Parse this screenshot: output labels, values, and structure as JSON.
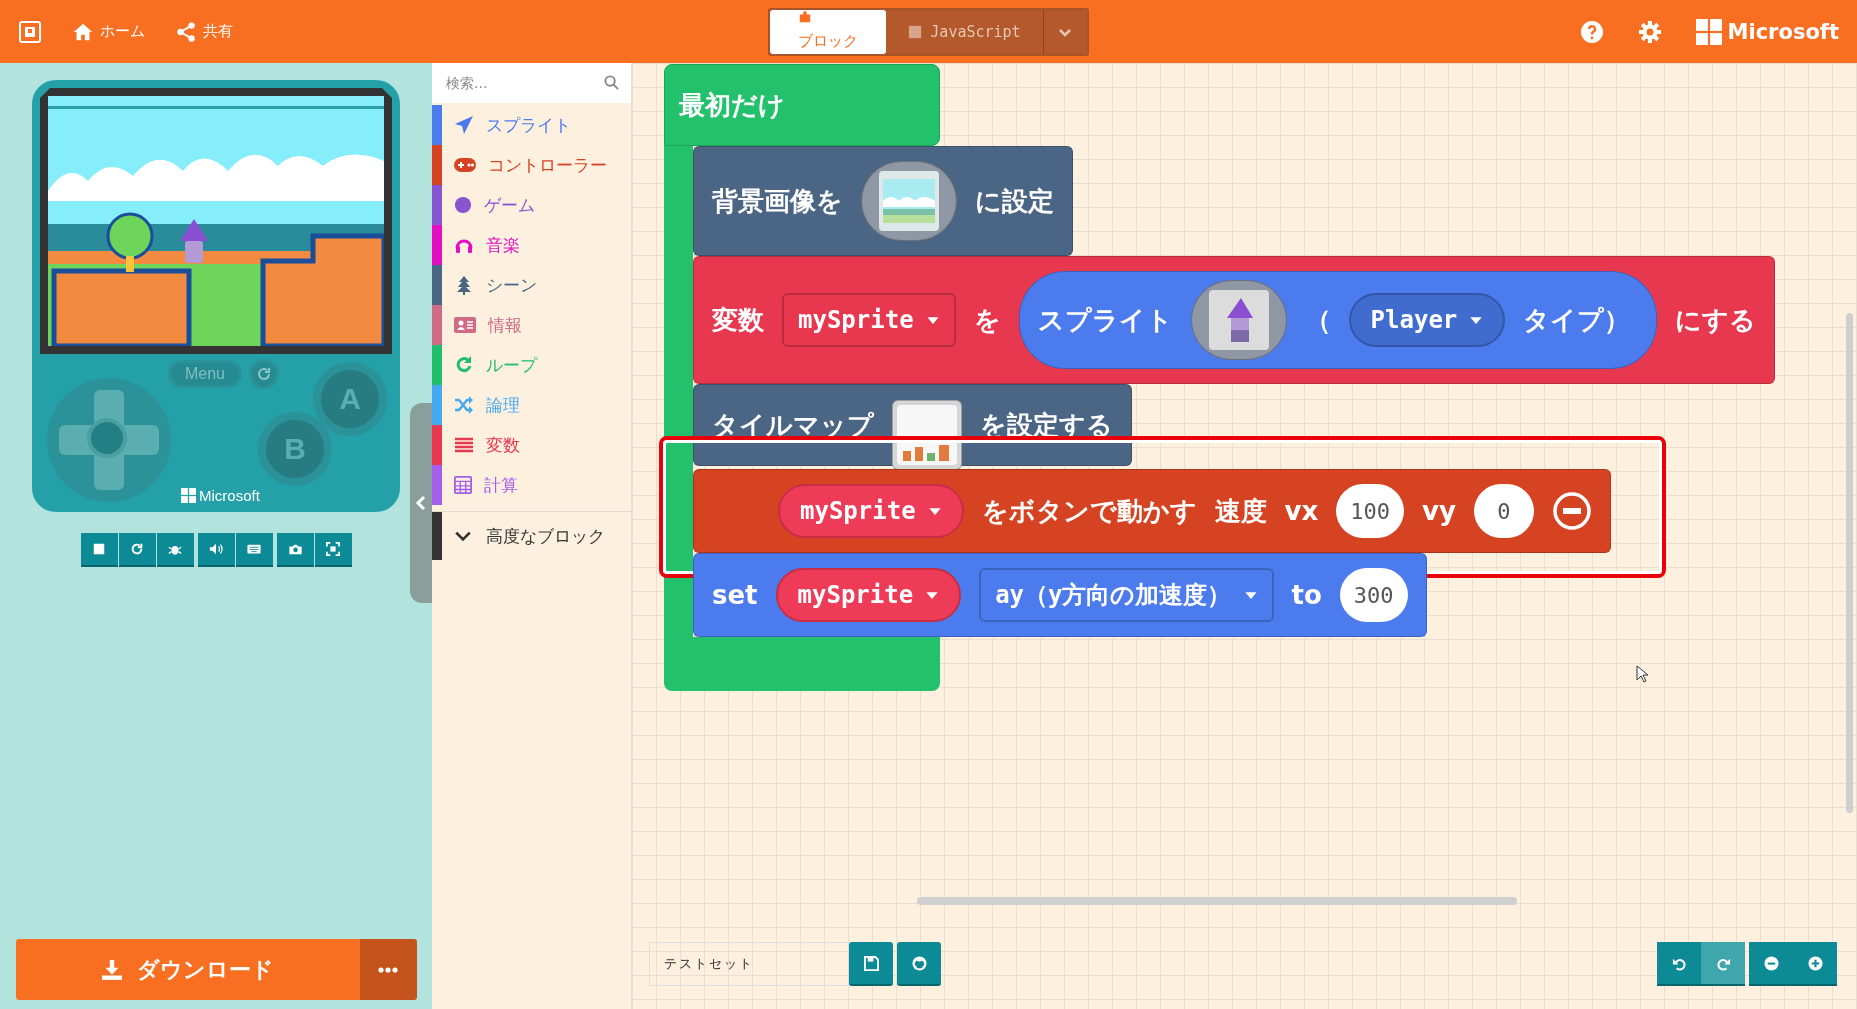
{
  "header": {
    "nav": [
      {
        "kind": "home",
        "label": "ホーム"
      },
      {
        "kind": "share",
        "label": "共有"
      }
    ],
    "mode_tabs": [
      {
        "kind": "blocks",
        "label": "ブロック",
        "selected": true
      },
      {
        "kind": "javascript",
        "label": "JavaScript",
        "selected": false
      }
    ],
    "brand": "Microsoft"
  },
  "simulator": {
    "menu": "Menu",
    "a_button": "A",
    "b_button": "B",
    "brand": "Microsoft"
  },
  "download": {
    "label": "ダウンロード"
  },
  "toolbox": {
    "search": {
      "placeholder": "検索..."
    },
    "categories": [
      {
        "kind": "sprites",
        "label": "スプライト",
        "color": "#4b7bec"
      },
      {
        "kind": "controller",
        "label": "コントローラー",
        "color": "#d54322"
      },
      {
        "kind": "game",
        "label": "ゲーム",
        "color": "#8854d0"
      },
      {
        "kind": "music",
        "label": "音楽",
        "color": "#e30fc0"
      },
      {
        "kind": "scene",
        "label": "シーン",
        "color": "#4b6584"
      },
      {
        "kind": "info",
        "label": "情報",
        "color": "#cf6a87"
      },
      {
        "kind": "loops",
        "label": "ループ",
        "color": "#20bf6b"
      },
      {
        "kind": "logic",
        "label": "論理",
        "color": "#45aaf2"
      },
      {
        "kind": "variables",
        "label": "変数",
        "color": "#e8384f"
      },
      {
        "kind": "math",
        "label": "計算",
        "color": "#a55eea"
      }
    ],
    "advanced": {
      "label": "高度なブロック"
    }
  },
  "workspace": {
    "event": {
      "label": "最初だけ",
      "color": "#23c16b"
    },
    "blocks": [
      {
        "color": "#4b6584",
        "highlighted": false,
        "parts": [
          {
            "kind": "text",
            "text": "背景画像を"
          },
          {
            "kind": "background-image"
          },
          {
            "kind": "text",
            "text": "に設定"
          }
        ]
      },
      {
        "color": "#e8384f",
        "highlighted": false,
        "parts": [
          {
            "kind": "text",
            "text": "変数"
          },
          {
            "kind": "dropdown",
            "text": "mySprite"
          },
          {
            "kind": "text",
            "text": "を"
          },
          {
            "kind": "reporter",
            "color": "#4b7bec",
            "parts": [
              {
                "kind": "text",
                "text": "スプライト"
              },
              {
                "kind": "sprite-image"
              },
              {
                "kind": "text",
                "text": "（"
              },
              {
                "kind": "enum",
                "text": "Player"
              },
              {
                "kind": "text",
                "text": "タイプ）"
              }
            ]
          },
          {
            "kind": "text",
            "text": "にする"
          }
        ]
      },
      {
        "color": "#4b6584",
        "highlighted": false,
        "parts": [
          {
            "kind": "text",
            "text": "タイルマップ"
          },
          {
            "kind": "tilemap-image"
          },
          {
            "kind": "text",
            "text": "を設定する"
          }
        ]
      },
      {
        "color": "#d54322",
        "highlighted": true,
        "parts": [
          {
            "kind": "variable",
            "text": "mySprite"
          },
          {
            "kind": "text",
            "text": "をボタンで動かす"
          },
          {
            "kind": "text",
            "text": "速度"
          },
          {
            "kind": "text",
            "text": "vx"
          },
          {
            "kind": "number",
            "text": "100"
          },
          {
            "kind": "text",
            "text": "vy"
          },
          {
            "kind": "number",
            "text": "0"
          },
          {
            "kind": "remove"
          }
        ]
      },
      {
        "color": "#4b7bec",
        "highlighted": false,
        "parts": [
          {
            "kind": "text",
            "text": "set"
          },
          {
            "kind": "variable",
            "text": "mySprite"
          },
          {
            "kind": "dropdown",
            "text": "ay（y方向の加速度）"
          },
          {
            "kind": "text",
            "text": "to"
          },
          {
            "kind": "number",
            "text": "300"
          }
        ]
      }
    ]
  },
  "project": {
    "name": "テストセット"
  },
  "history": {
    "undo_disabled": false,
    "redo_disabled": true
  }
}
